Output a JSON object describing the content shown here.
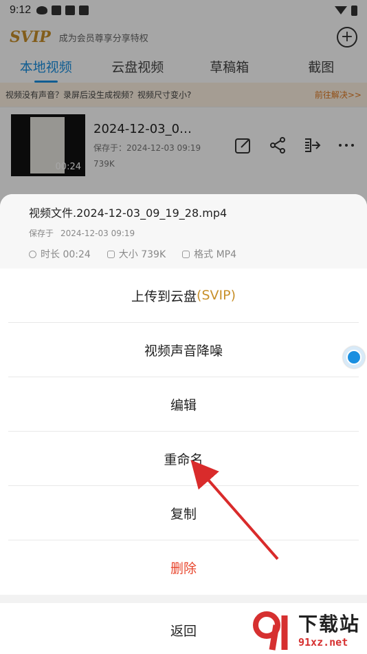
{
  "status_bar": {
    "time": "9:12"
  },
  "header": {
    "logo": "SVIP",
    "tagline": "成为会员尊享分享特权",
    "add_icon": "plus-circle-icon"
  },
  "tabs": [
    {
      "label": "本地视频",
      "active": true
    },
    {
      "label": "云盘视频",
      "active": false
    },
    {
      "label": "草稿箱",
      "active": false
    },
    {
      "label": "截图",
      "active": false
    }
  ],
  "notice": {
    "text": "视频没有声音？录屏后没生成视频？视频尺寸变小?",
    "link": "前往解决>>"
  },
  "video": {
    "name": "2024-12-03_0…",
    "saved": "保存于：2024-12-03 09:19",
    "size": "739K",
    "duration": "00:24"
  },
  "sheet": {
    "file_name": "视频文件.2024-12-03_09_19_28.mp4",
    "saved_label": "保存于",
    "saved_time": "2024-12-03 09:19",
    "duration": "时长 00:24",
    "size": "大小 739K",
    "format": "格式 MP4",
    "menu": {
      "upload": "上传到云盘",
      "upload_tag": "(SVIP)",
      "denoise": "视频声音降噪",
      "edit": "编辑",
      "rename": "重命名",
      "copy": "复制",
      "delete": "删除"
    },
    "back": "返回"
  },
  "watermark": {
    "title": "下载站",
    "site": "91xz.net"
  },
  "colors": {
    "accent": "#1a8fe0",
    "vip_gold": "#c8902a",
    "danger": "#e8452c",
    "arrow": "#d92b2b"
  }
}
